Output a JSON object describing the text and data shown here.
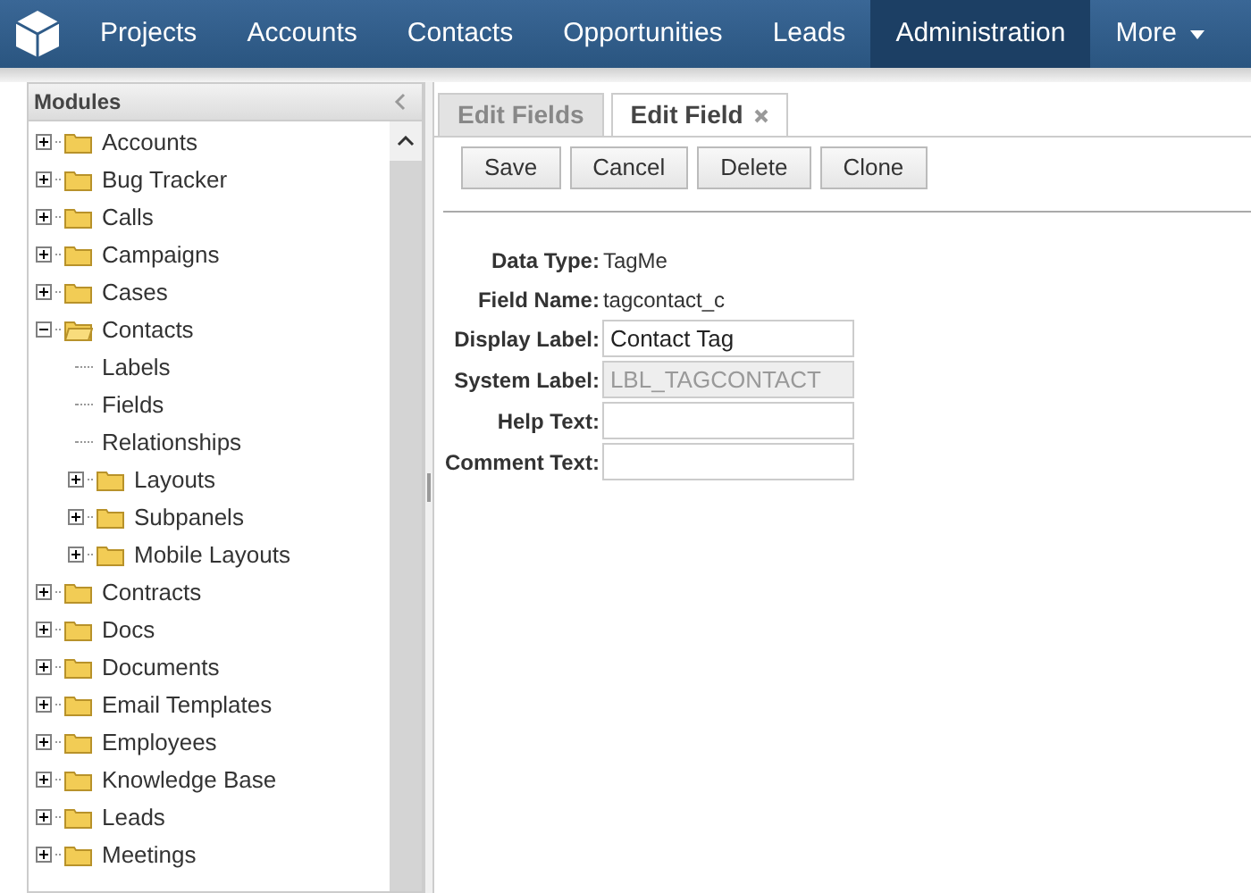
{
  "nav": {
    "items": [
      {
        "label": "Projects",
        "selected": false
      },
      {
        "label": "Accounts",
        "selected": false
      },
      {
        "label": "Contacts",
        "selected": false
      },
      {
        "label": "Opportunities",
        "selected": false
      },
      {
        "label": "Leads",
        "selected": false
      },
      {
        "label": "Administration",
        "selected": true
      },
      {
        "label": "More",
        "selected": false,
        "dropdown": true
      }
    ]
  },
  "sidebar": {
    "title": "Modules",
    "tree": [
      {
        "label": "Accounts",
        "kind": "folder",
        "expanded": false
      },
      {
        "label": "Bug Tracker",
        "kind": "folder",
        "expanded": false
      },
      {
        "label": "Calls",
        "kind": "folder",
        "expanded": false
      },
      {
        "label": "Campaigns",
        "kind": "folder",
        "expanded": false
      },
      {
        "label": "Cases",
        "kind": "folder",
        "expanded": false
      },
      {
        "label": "Contacts",
        "kind": "folder",
        "expanded": true,
        "children": [
          {
            "label": "Labels",
            "kind": "leaf"
          },
          {
            "label": "Fields",
            "kind": "leaf"
          },
          {
            "label": "Relationships",
            "kind": "leaf"
          },
          {
            "label": "Layouts",
            "kind": "folder",
            "expanded": false
          },
          {
            "label": "Subpanels",
            "kind": "folder",
            "expanded": false
          },
          {
            "label": "Mobile Layouts",
            "kind": "folder",
            "expanded": false
          }
        ]
      },
      {
        "label": "Contracts",
        "kind": "folder",
        "expanded": false
      },
      {
        "label": "Docs",
        "kind": "folder",
        "expanded": false
      },
      {
        "label": "Documents",
        "kind": "folder",
        "expanded": false
      },
      {
        "label": "Email Templates",
        "kind": "folder",
        "expanded": false
      },
      {
        "label": "Employees",
        "kind": "folder",
        "expanded": false
      },
      {
        "label": "Knowledge Base",
        "kind": "folder",
        "expanded": false
      },
      {
        "label": "Leads",
        "kind": "folder",
        "expanded": false
      },
      {
        "label": "Meetings",
        "kind": "folder",
        "expanded": false
      }
    ]
  },
  "tabs": [
    {
      "label": "Edit Fields",
      "selected": false,
      "closable": false
    },
    {
      "label": "Edit Field",
      "selected": true,
      "closable": true
    }
  ],
  "buttons": [
    "Save",
    "Cancel",
    "Delete",
    "Clone"
  ],
  "fields": [
    {
      "label": "Data Type:",
      "kind": "text",
      "value": "TagMe"
    },
    {
      "label": "Field Name:",
      "kind": "text",
      "value": "tagcontact_c"
    },
    {
      "label": "Display Label:",
      "kind": "input",
      "value": "Contact Tag",
      "disabled": false
    },
    {
      "label": "System Label:",
      "kind": "input",
      "value": "LBL_TAGCONTACT",
      "disabled": true
    },
    {
      "label": "Help Text:",
      "kind": "input",
      "disabled": false
    },
    {
      "label": "Comment Text:",
      "kind": "input",
      "disabled": false
    }
  ]
}
